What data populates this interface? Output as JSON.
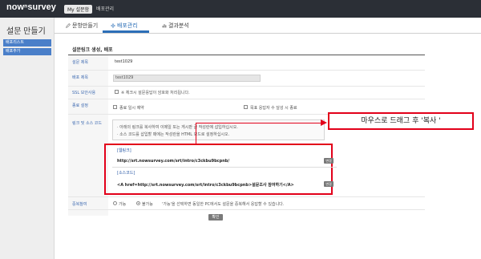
{
  "topbar": {
    "logo": "nowⁿsurvey",
    "nav": [
      "My 설문함",
      "배포관리"
    ]
  },
  "sidebar": {
    "title": "설문 만들기",
    "items": [
      "배포리스트",
      "배포추가"
    ]
  },
  "tabs": [
    {
      "label": "문항만들기",
      "icon": "pencil-icon",
      "active": false
    },
    {
      "label": "배포관리",
      "icon": "network-icon",
      "active": true
    },
    {
      "label": "결과분석",
      "icon": "chart-icon",
      "active": false
    }
  ],
  "form": {
    "section_title": "설문링크 생성, 배포",
    "survey_title_label": "설문 제목",
    "survey_title_value": "test1029",
    "deploy_title_label": "배포 제목",
    "deploy_title_value": "test1029",
    "ssl_label": "SSL 보안사용",
    "ssl_text": "※ 체크시 설문응답이 암호화 처리됩니다.",
    "end_label": "종료 설정",
    "end_option_1": "종료 일시 예약",
    "end_option_2": "목표 응답자 수 달성 시 종료",
    "link_label": "링크 및 소스 코드",
    "notice_1": "· 아래의 링크를 복사하여 이메일 또는 게시판 글 작성란에 삽입하십시오.",
    "notice_2": "· 소스 코드를 삽입할 때에는 작성란을 HTML 모드로 설정하십시오.",
    "link_heading": "[웹링크]",
    "link_url": "http://srt.nowsurvey.com/srt/intro/c3ckbu9bcpnb/",
    "source_heading": "[소스코드]",
    "source_code": "<A href=http://srt.nowsurvey.com/srt/intro/c3ckbu9bcpnb>설문조사 참여하기</A>",
    "change_btn": "변경",
    "dup_label": "중복참여",
    "dup_option_1": "가능",
    "dup_option_2": "불가능",
    "dup_help": "'가능'을 선택하면 동일한 PC에서도 설문을 중복해서 응답할 수 있습니다.",
    "confirm": "확인"
  },
  "callout": "마우스로 드래그 후 '복사 '",
  "colors": {
    "accent": "#2c6fb7",
    "highlight": "#e2001a",
    "sidebar_item": "#4a7fc9"
  }
}
